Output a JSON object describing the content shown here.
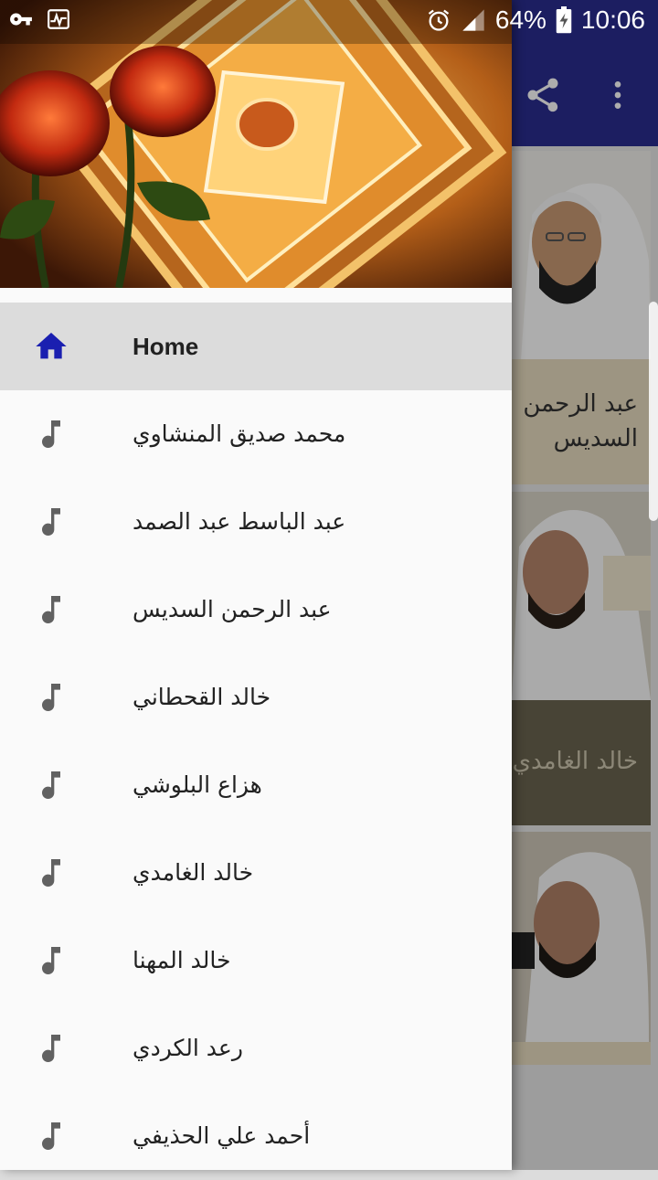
{
  "status_bar": {
    "battery": "64%",
    "time": "10:06"
  },
  "app_bar": {
    "color": "#2a2d8f",
    "actions": [
      "share-icon",
      "overflow-menu-icon"
    ]
  },
  "background_cards": [
    {
      "caption_line1": "عبد الرحمن",
      "caption_line2": "السديس"
    },
    {
      "caption_line1": "خالد الغامدي"
    }
  ],
  "drawer": {
    "menu": [
      {
        "label": "Home",
        "icon": "home-icon",
        "active": true
      },
      {
        "label": "محمد صديق المنشاوي",
        "icon": "music-note-icon"
      },
      {
        "label": "عبد الباسط عبد الصمد",
        "icon": "music-note-icon"
      },
      {
        "label": "عبد الرحمن السديس",
        "icon": "music-note-icon"
      },
      {
        "label": "خالد القحطاني",
        "icon": "music-note-icon"
      },
      {
        "label": "هزاع البلوشي",
        "icon": "music-note-icon"
      },
      {
        "label": "خالد الغامدي",
        "icon": "music-note-icon"
      },
      {
        "label": "خالد المهنا",
        "icon": "music-note-icon"
      },
      {
        "label": "رعد الكردي",
        "icon": "music-note-icon"
      },
      {
        "label": "أحمد علي الحذيفي",
        "icon": "music-note-icon"
      }
    ]
  },
  "colors": {
    "accent": "#1a1fb0",
    "icon_gray": "#616161",
    "active_item_bg": "#dcdcdc"
  }
}
